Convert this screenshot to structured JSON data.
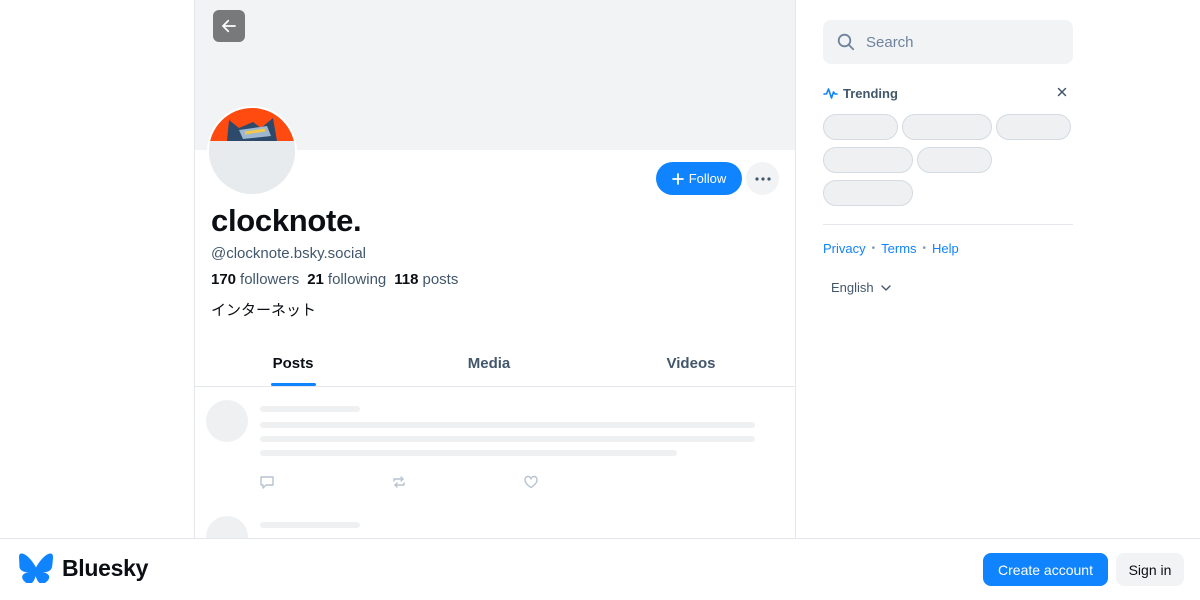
{
  "profile": {
    "display_name": "clocknote.",
    "handle": "@clocknote.bsky.social",
    "followers_count": "170",
    "followers_label": "followers",
    "following_count": "21",
    "following_label": "following",
    "posts_count": "118",
    "posts_label": "posts",
    "bio": "インターネット",
    "follow_label": "Follow"
  },
  "tabs": [
    {
      "label": "Posts",
      "active": true
    },
    {
      "label": "Media",
      "active": false
    },
    {
      "label": "Videos",
      "active": false
    }
  ],
  "sidebar": {
    "search_placeholder": "Search",
    "trending_title": "Trending",
    "links": [
      "Privacy",
      "Terms",
      "Help"
    ],
    "language": "English"
  },
  "bottom_bar": {
    "brand": "Bluesky",
    "create_account": "Create account",
    "sign_in": "Sign in"
  },
  "colors": {
    "accent": "#1083fe",
    "banner": "#f1f3f5",
    "avatar_background": "#ff4a10"
  },
  "icons": {
    "back": "arrow-left-icon",
    "follow": "plus-icon",
    "more": "ellipsis-icon",
    "search": "search-icon",
    "trending": "trending-icon",
    "close": "close-icon",
    "language": "chevron-down-icon",
    "reply": "reply-icon",
    "repost": "repost-icon",
    "like": "heart-icon",
    "brand": "butterfly-icon"
  }
}
